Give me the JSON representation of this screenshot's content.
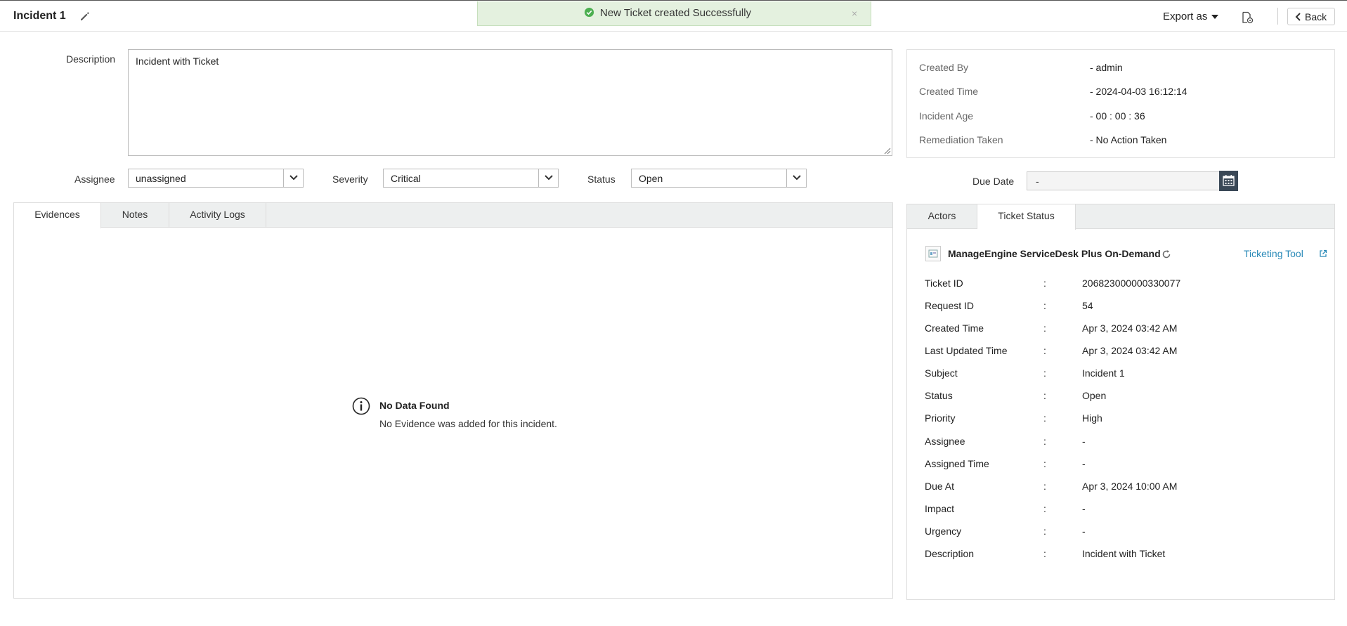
{
  "header": {
    "title": "Incident 1",
    "export_label": "Export as",
    "back_label": "Back"
  },
  "toast": {
    "message": "New Ticket created Successfully",
    "close": "×"
  },
  "form": {
    "description_label": "Description",
    "description_value": "Incident with Ticket",
    "assignee_label": "Assignee",
    "assignee_value": "unassigned",
    "severity_label": "Severity",
    "severity_value": "Critical",
    "status_label": "Status",
    "status_value": "Open",
    "due_date_label": "Due Date",
    "due_date_value": "-"
  },
  "info": {
    "rows": [
      {
        "label": "Created By",
        "value": "- admin"
      },
      {
        "label": "Created Time",
        "value": "- 2024-04-03 16:12:14"
      },
      {
        "label": "Incident Age",
        "value": "- 00 : 00 : 36"
      },
      {
        "label": "Remediation Taken",
        "value": "- No Action Taken"
      }
    ]
  },
  "left_tabs": {
    "tabs": [
      {
        "label": "Evidences"
      },
      {
        "label": "Notes"
      },
      {
        "label": "Activity Logs"
      }
    ],
    "empty_title": "No Data Found",
    "empty_message": "No Evidence was added for this incident."
  },
  "right_tabs": {
    "tabs": [
      {
        "label": "Actors"
      },
      {
        "label": "Ticket Status"
      }
    ],
    "tool_name": "ManageEngine ServiceDesk Plus On-Demand",
    "tool_link": "Ticketing Tool",
    "separator": ":",
    "fields": [
      {
        "key": "Ticket ID",
        "value": "206823000000330077"
      },
      {
        "key": "Request ID",
        "value": "54"
      },
      {
        "key": "Created Time",
        "value": "Apr 3, 2024 03:42 AM"
      },
      {
        "key": "Last Updated Time",
        "value": "Apr 3, 2024 03:42 AM"
      },
      {
        "key": "Subject",
        "value": "Incident 1"
      },
      {
        "key": "Status",
        "value": "Open"
      },
      {
        "key": "Priority",
        "value": "High"
      },
      {
        "key": "Assignee",
        "value": "-"
      },
      {
        "key": "Assigned Time",
        "value": "-"
      },
      {
        "key": "Due At",
        "value": "Apr 3, 2024 10:00 AM"
      },
      {
        "key": "Impact",
        "value": "-"
      },
      {
        "key": "Urgency",
        "value": "-"
      },
      {
        "key": "Description",
        "value": "Incident with Ticket"
      }
    ]
  },
  "colors": {
    "toast_bg": "#e4f1df",
    "toast_icon": "#4caf50",
    "link": "#2a8ab8",
    "calendar_button": "#3a4856",
    "tab_strip": "#edefef"
  }
}
